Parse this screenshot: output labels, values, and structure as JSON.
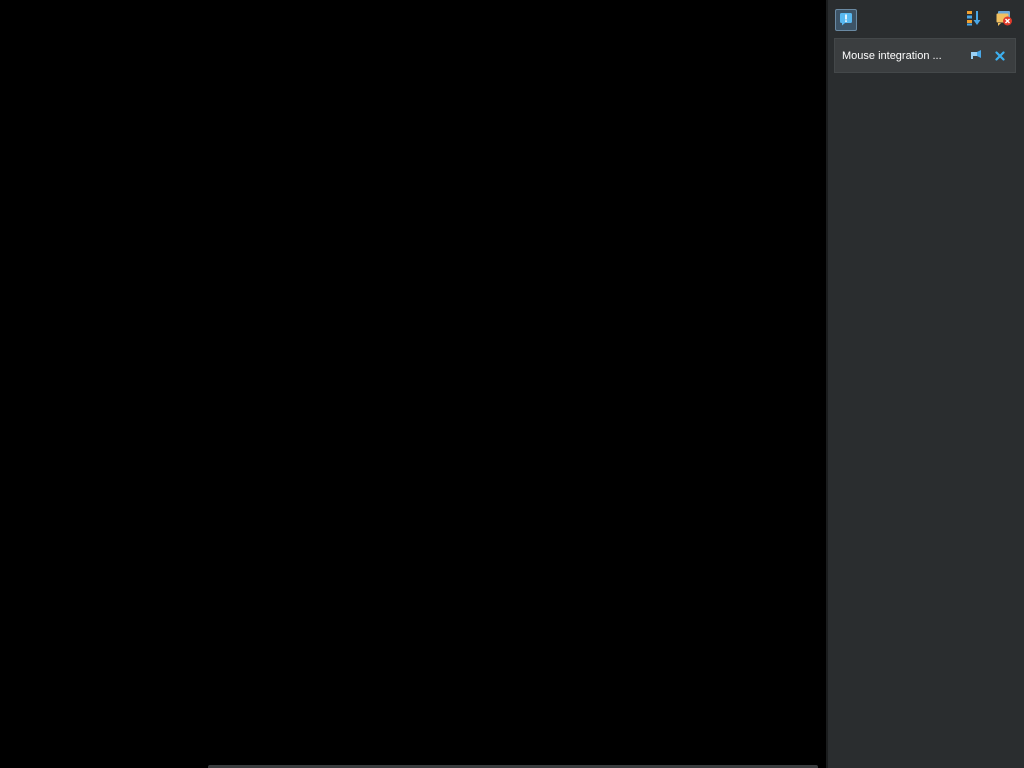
{
  "notification_center": {
    "toolbar": {
      "toggle_icon": "exclamation-icon",
      "sort_icon": "sort-icon",
      "clear_icon": "clear-all-icon"
    },
    "notifications": [
      {
        "text": "Mouse integration ...",
        "icon_pin": "pin-icon",
        "icon_close": "close-icon"
      }
    ]
  },
  "colors": {
    "display_bg": "#000000",
    "panel_bg": "#2a2d2f",
    "card_bg": "#3b3e40",
    "accent": "#3cb0f0"
  }
}
